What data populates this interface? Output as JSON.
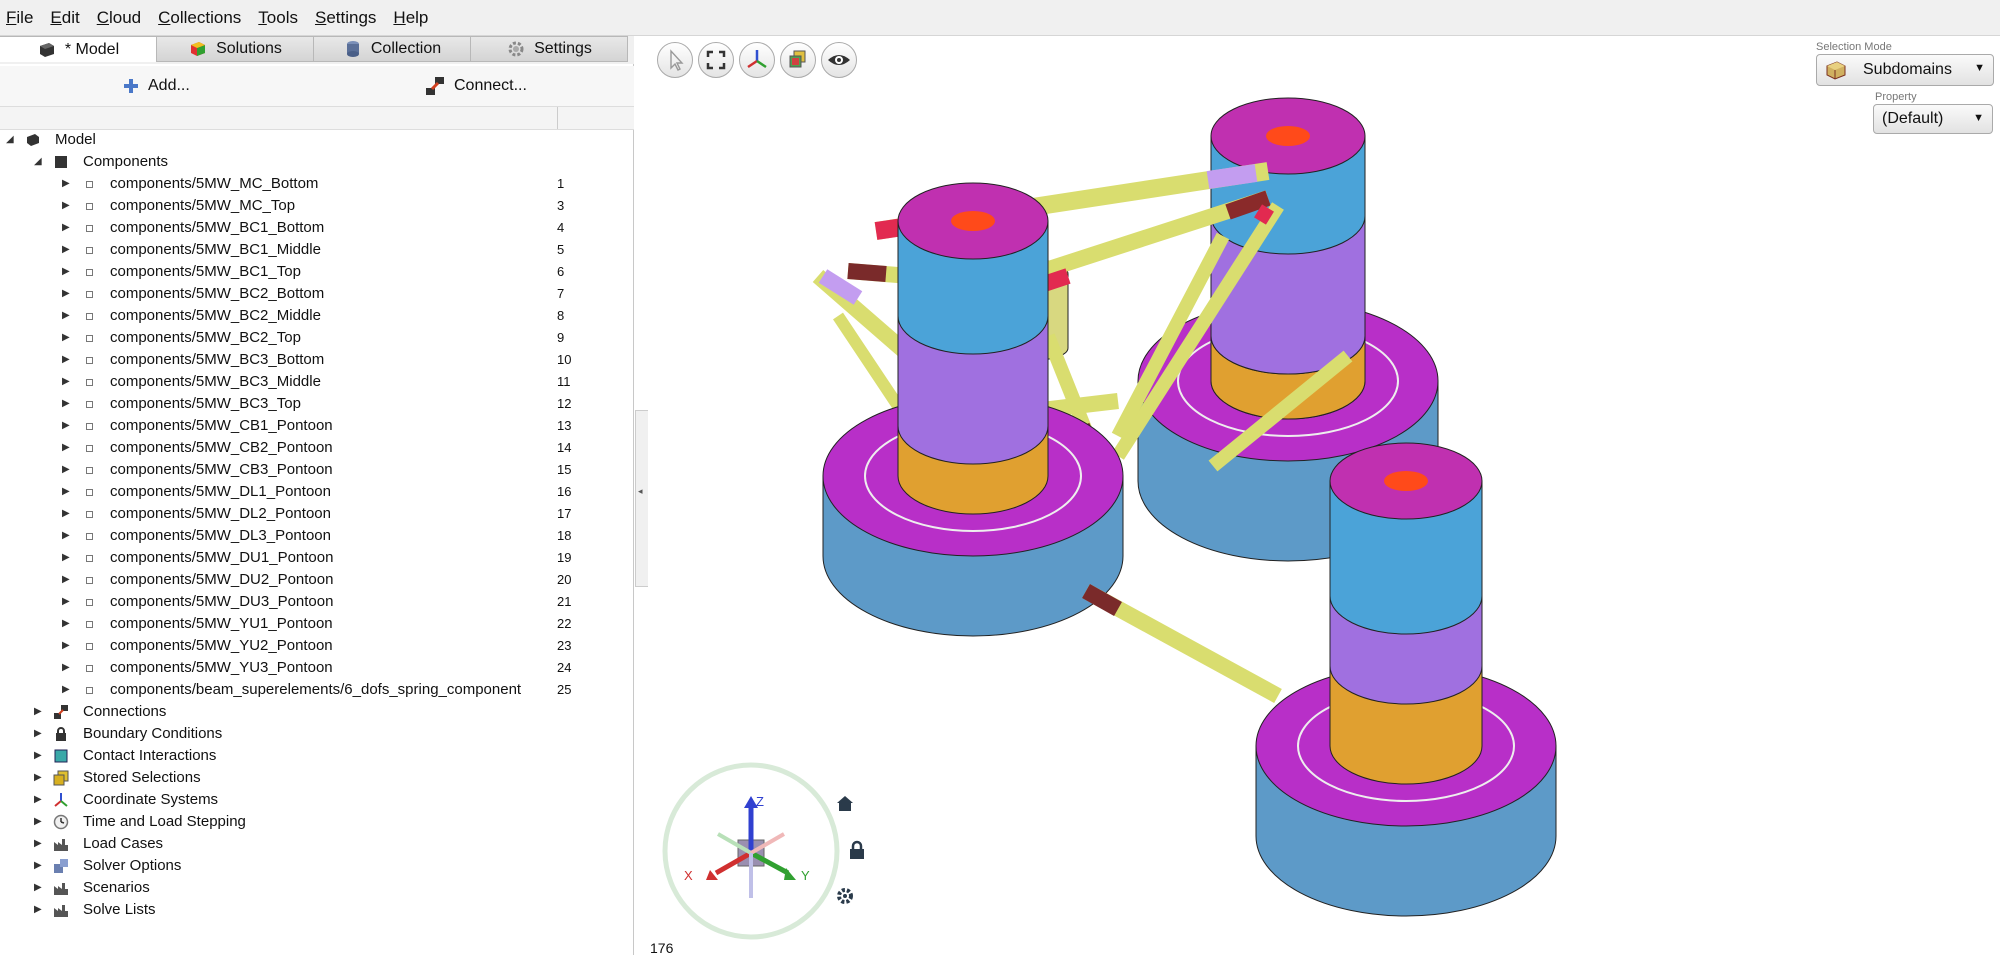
{
  "menu": [
    {
      "label": "File",
      "u": "F",
      "rest": "ile"
    },
    {
      "label": "Edit",
      "u": "E",
      "rest": "dit"
    },
    {
      "label": "Cloud",
      "u": "C",
      "rest": "loud"
    },
    {
      "label": "Collections",
      "u": "C",
      "rest": "ollections"
    },
    {
      "label": "Tools",
      "u": "T",
      "rest": "ools"
    },
    {
      "label": "Settings",
      "u": "S",
      "rest": "ettings"
    },
    {
      "label": "Help",
      "u": "H",
      "rest": "elp"
    }
  ],
  "tabs": {
    "model": "* Model",
    "solutions": "Solutions",
    "collection": "Collection",
    "settings": "Settings"
  },
  "toolbar": {
    "add": "Add...",
    "connect": "Connect..."
  },
  "tree": {
    "model": "Model",
    "components": "Components",
    "items": [
      {
        "label": "components/5MW_MC_Bottom",
        "num": "1"
      },
      {
        "label": "components/5MW_MC_Top",
        "num": "3"
      },
      {
        "label": "components/5MW_BC1_Bottom",
        "num": "4"
      },
      {
        "label": "components/5MW_BC1_Middle",
        "num": "5"
      },
      {
        "label": "components/5MW_BC1_Top",
        "num": "6"
      },
      {
        "label": "components/5MW_BC2_Bottom",
        "num": "7"
      },
      {
        "label": "components/5MW_BC2_Middle",
        "num": "8"
      },
      {
        "label": "components/5MW_BC2_Top",
        "num": "9"
      },
      {
        "label": "components/5MW_BC3_Bottom",
        "num": "10"
      },
      {
        "label": "components/5MW_BC3_Middle",
        "num": "11"
      },
      {
        "label": "components/5MW_BC3_Top",
        "num": "12"
      },
      {
        "label": "components/5MW_CB1_Pontoon",
        "num": "13"
      },
      {
        "label": "components/5MW_CB2_Pontoon",
        "num": "14"
      },
      {
        "label": "components/5MW_CB3_Pontoon",
        "num": "15"
      },
      {
        "label": "components/5MW_DL1_Pontoon",
        "num": "16"
      },
      {
        "label": "components/5MW_DL2_Pontoon",
        "num": "17"
      },
      {
        "label": "components/5MW_DL3_Pontoon",
        "num": "18"
      },
      {
        "label": "components/5MW_DU1_Pontoon",
        "num": "19"
      },
      {
        "label": "components/5MW_DU2_Pontoon",
        "num": "20"
      },
      {
        "label": "components/5MW_DU3_Pontoon",
        "num": "21"
      },
      {
        "label": "components/5MW_YU1_Pontoon",
        "num": "22"
      },
      {
        "label": "components/5MW_YU2_Pontoon",
        "num": "23"
      },
      {
        "label": "components/5MW_YU3_Pontoon",
        "num": "24"
      },
      {
        "label": "components/beam_superelements/6_dofs_spring_component",
        "num": "25"
      }
    ],
    "sections": [
      {
        "label": "Connections",
        "icon": "connection-icon"
      },
      {
        "label": "Boundary Conditions",
        "icon": "lock-icon"
      },
      {
        "label": "Contact Interactions",
        "icon": "contact-icon"
      },
      {
        "label": "Stored Selections",
        "icon": "selection-icon"
      },
      {
        "label": "Coordinate Systems",
        "icon": "axes-icon"
      },
      {
        "label": "Time and Load Stepping",
        "icon": "clock-icon"
      },
      {
        "label": "Load Cases",
        "icon": "factory-icon"
      },
      {
        "label": "Solver Options",
        "icon": "solver-icon"
      },
      {
        "label": "Scenarios",
        "icon": "factory-icon"
      },
      {
        "label": "Solve Lists",
        "icon": "factory-icon"
      }
    ]
  },
  "viewport": {
    "selection_mode_label": "Selection Mode",
    "selection_mode": "Subdomains",
    "property_label": "Property",
    "property": "(Default)",
    "count": "176",
    "axes": {
      "z": "Z",
      "x": "X",
      "y": "Y"
    }
  }
}
